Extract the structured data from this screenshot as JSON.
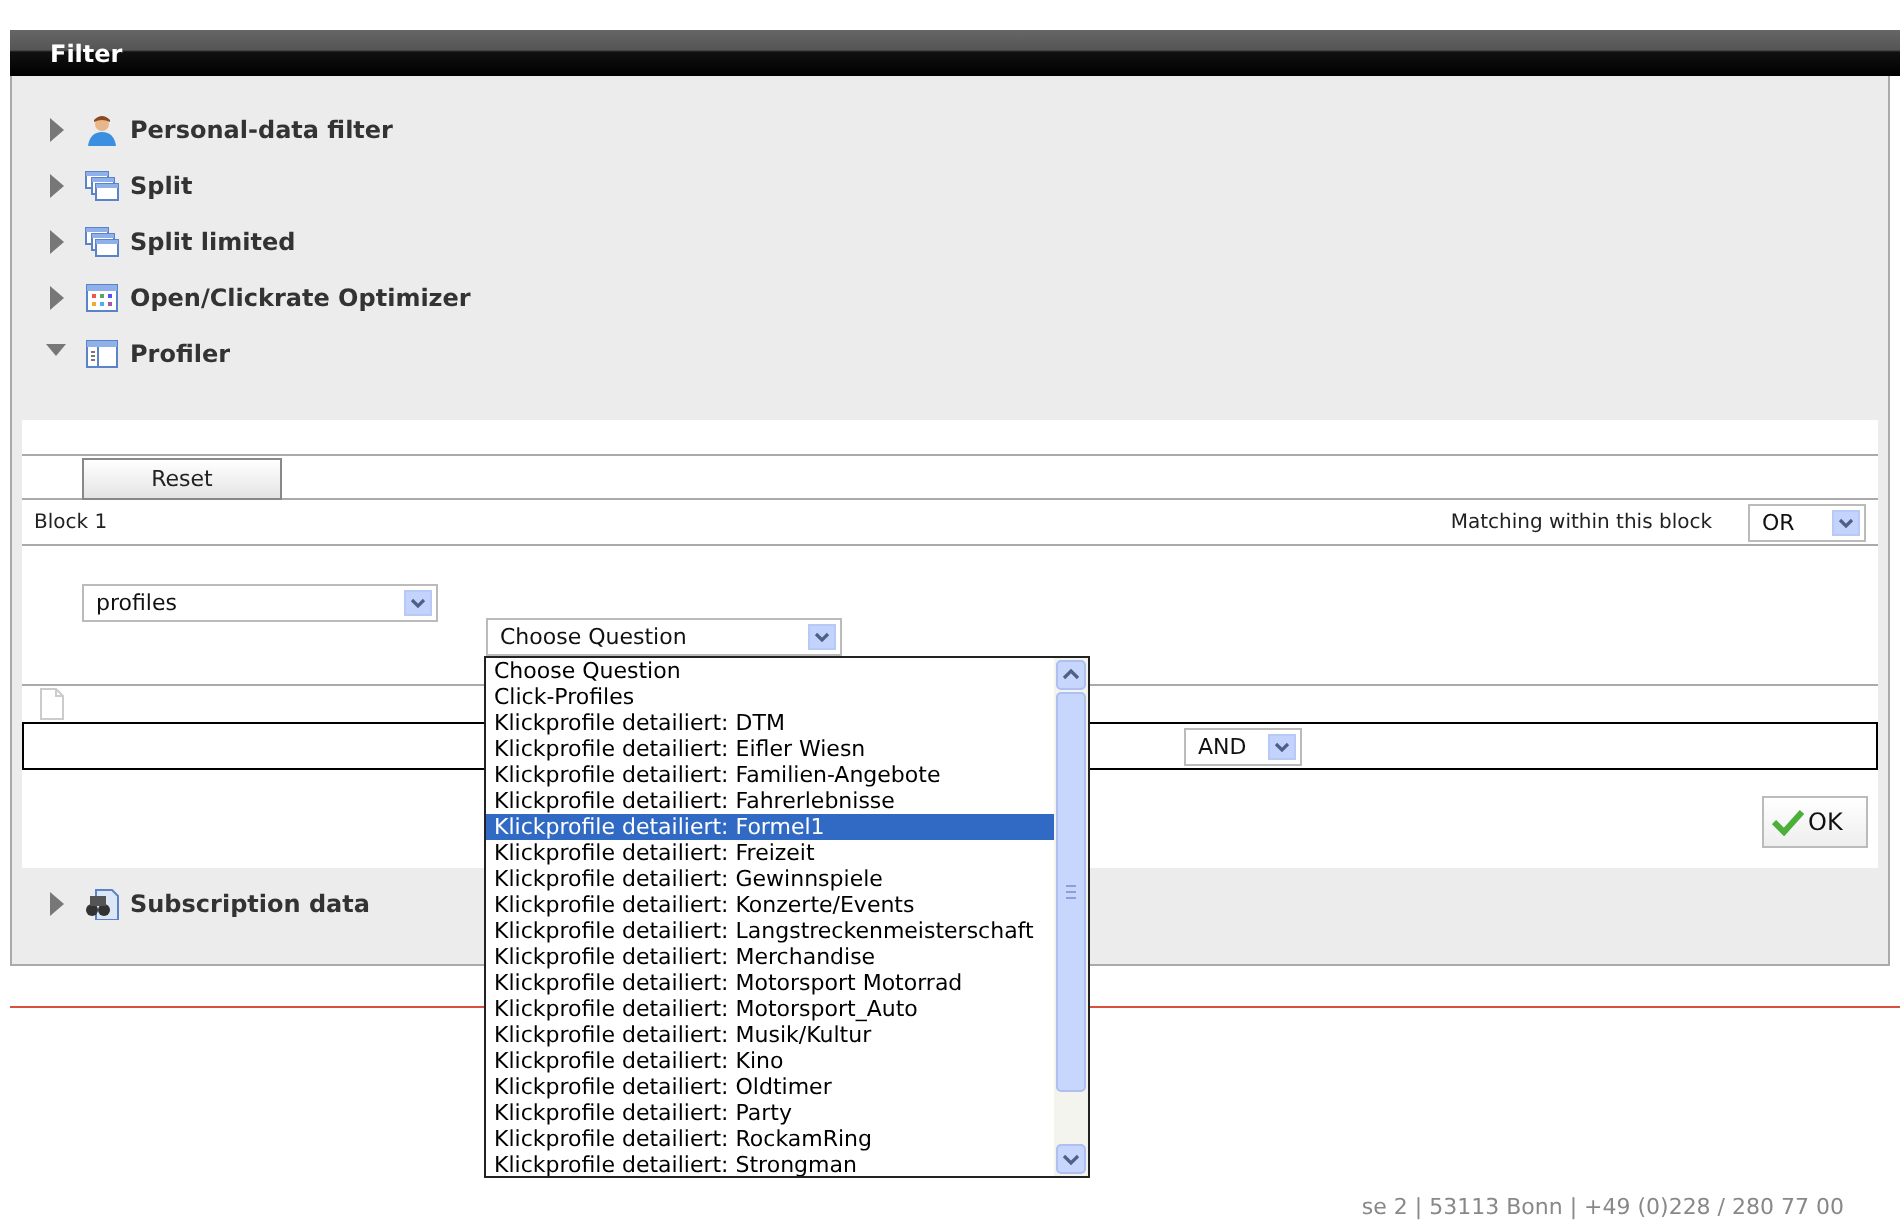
{
  "header": {
    "title": "Filter"
  },
  "sections": [
    {
      "label": "Personal-data filter",
      "kind": "person",
      "expanded": false
    },
    {
      "label": "Split",
      "kind": "windows",
      "expanded": false
    },
    {
      "label": "Split limited",
      "kind": "windows",
      "expanded": false
    },
    {
      "label": "Open/Clickrate Optimizer",
      "kind": "calendar",
      "expanded": false
    },
    {
      "label": "Profiler",
      "kind": "profiler",
      "expanded": true
    },
    {
      "label": "Subscription data",
      "kind": "subscription",
      "expanded": false
    }
  ],
  "profiler": {
    "reset_button": "Reset",
    "block_title": "Block 1",
    "matching_label": "Matching within this block",
    "matching_value": "OR",
    "source_value": "profiles",
    "question_value": "Choose Question",
    "question_options": [
      {
        "label": "Choose Question",
        "selected": false
      },
      {
        "label": "Click-Profiles",
        "selected": false
      },
      {
        "label": "Klickprofile detailiert: DTM",
        "selected": false
      },
      {
        "label": "Klickprofile detailiert: Eifler Wiesn",
        "selected": false
      },
      {
        "label": "Klickprofile detailiert: Familien-Angebote",
        "selected": false
      },
      {
        "label": "Klickprofile detailiert: Fahrerlebnisse",
        "selected": false
      },
      {
        "label": "Klickprofile detailiert: Formel1",
        "selected": true
      },
      {
        "label": "Klickprofile detailiert: Freizeit",
        "selected": false
      },
      {
        "label": "Klickprofile detailiert: Gewinnspiele",
        "selected": false
      },
      {
        "label": "Klickprofile detailiert: Konzerte/Events",
        "selected": false
      },
      {
        "label": "Klickprofile detailiert: Langstreckenmeisterschaft",
        "selected": false
      },
      {
        "label": "Klickprofile detailiert: Merchandise",
        "selected": false
      },
      {
        "label": "Klickprofile detailiert: Motorsport Motorrad",
        "selected": false
      },
      {
        "label": "Klickprofile detailiert: Motorsport_Auto",
        "selected": false
      },
      {
        "label": "Klickprofile detailiert: Musik/Kultur",
        "selected": false
      },
      {
        "label": "Klickprofile detailiert: Kino",
        "selected": false
      },
      {
        "label": "Klickprofile detailiert: Oldtimer",
        "selected": false
      },
      {
        "label": "Klickprofile detailiert: Party",
        "selected": false
      },
      {
        "label": "Klickprofile detailiert: RockamRing",
        "selected": false
      },
      {
        "label": "Klickprofile detailiert: Strongman",
        "selected": false
      }
    ],
    "combine_value": "AND",
    "ok_button": "OK"
  },
  "footer": {
    "address": "se 2 | 53113 Bonn | +49 (0)228 / 280 77 00"
  }
}
